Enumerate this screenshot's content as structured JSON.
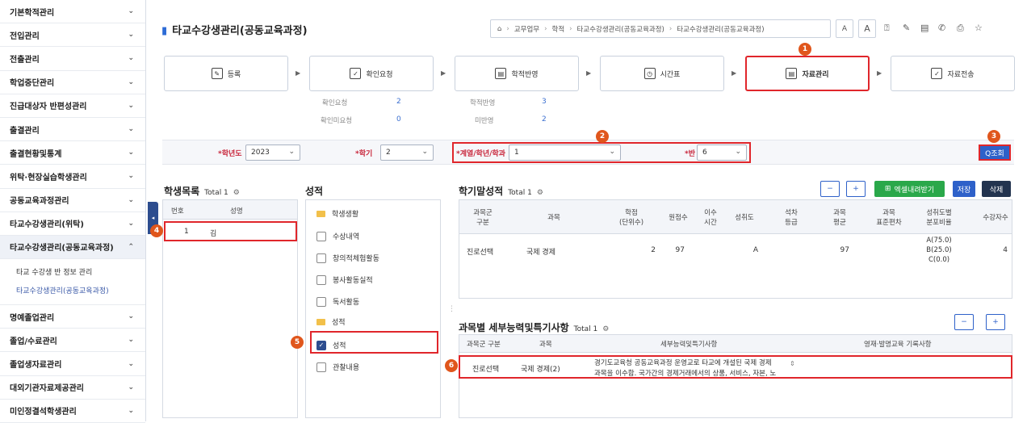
{
  "sidebar": {
    "items": [
      {
        "label": "기본학적관리"
      },
      {
        "label": "전입관리"
      },
      {
        "label": "전출관리"
      },
      {
        "label": "학업중단관리"
      },
      {
        "label": "진급대상자 반편성관리"
      },
      {
        "label": "출결관리"
      },
      {
        "label": "출결현황및통계"
      },
      {
        "label": "위탁·현장실습학생관리"
      },
      {
        "label": "공동교육과정관리"
      },
      {
        "label": "타교수강생관리(위탁)"
      },
      {
        "label": "타교수강생관리(공동교육과정)"
      }
    ],
    "subitems": [
      {
        "label": "타교 수강생 반 정보 관리"
      },
      {
        "label": "타교수강생관리(공동교육과정)"
      }
    ],
    "items_after": [
      {
        "label": "명예졸업관리"
      },
      {
        "label": "졸업/수료관리"
      },
      {
        "label": "졸업생자료관리"
      },
      {
        "label": "대외기관자료제공관리"
      },
      {
        "label": "미인정결석학생관리"
      }
    ]
  },
  "page": {
    "title": "타교수강생관리(공동교육과정)"
  },
  "breadcrumb": [
    "⌂",
    "교무업무",
    "학적",
    "타교수강생관리(공동교육과정)",
    "타교수강생관리(공동교육과정)"
  ],
  "toolbar": {
    "font_small": "A",
    "font_large": "A"
  },
  "steps": [
    {
      "label": "등록",
      "icon": "register-icon"
    },
    {
      "label": "확인요청",
      "icon": "check-request-icon"
    },
    {
      "label": "학적반영",
      "icon": "apply-icon"
    },
    {
      "label": "시간표",
      "icon": "clock-icon"
    },
    {
      "label": "자료관리",
      "icon": "data-icon"
    },
    {
      "label": "자료전송",
      "icon": "send-icon"
    }
  ],
  "stats": {
    "confirm_req_label": "확인요청",
    "confirm_req_value": "2",
    "unconfirm_label": "확인미요청",
    "unconfirm_value": "0",
    "applied_label": "학적반영",
    "applied_value": "3",
    "unapplied_label": "미반영",
    "unapplied_value": "2"
  },
  "filter": {
    "year_label": "*학년도",
    "year_value": "2023",
    "term_label": "*학기",
    "term_value": "2",
    "grade_label": "*계열/학년/학과",
    "grade_value": "1",
    "class_label": "*반",
    "class_value": "6",
    "search_label": "Q조회"
  },
  "students": {
    "title": "학생목록",
    "total": "Total 1",
    "col_no": "번호",
    "col_name": "성명",
    "rows": [
      {
        "no": "1",
        "name": "김"
      }
    ]
  },
  "grades_tree": {
    "title": "성적",
    "group1": "학생생활",
    "items1": [
      "수상내역",
      "창의적체험활동",
      "봉사활동실적",
      "독서활동"
    ],
    "group2": "성적",
    "items2": [
      "성적",
      "관찰내용"
    ]
  },
  "term_grades": {
    "title": "학기말성적",
    "total": "Total 1",
    "btn_minus": "−",
    "btn_plus": "+",
    "btn_excel": "엑셀내려받기",
    "btn_save": "저장",
    "btn_delete": "삭제",
    "headers": [
      "과목군\n구분",
      "과목",
      "학점\n(단위수)",
      "원점수",
      "이수\n시간",
      "성취도",
      "석차\n등급",
      "과목\n평균",
      "과목\n표준편차",
      "성취도별\n분포비율",
      "수강자수"
    ],
    "row": {
      "group": "진로선택",
      "subject": "국제 경제",
      "credit": "2",
      "score": "97",
      "hours": "",
      "achievement": "A",
      "rank": "",
      "avg": "97",
      "std": "",
      "dist": [
        "A(75.0)",
        "B(25.0)",
        "C(0.0)"
      ],
      "count": "4"
    }
  },
  "details": {
    "title": "과목별 세부능력및특기사항",
    "total": "Total 1",
    "btn_minus": "−",
    "btn_plus": "+",
    "headers": [
      "과목군 구분",
      "과목",
      "세부능력및특기사항",
      "영재·발명교육 기록사항"
    ],
    "row": {
      "group": "진로선택",
      "subject": "국제 경제(2)",
      "text1": "경기도교육청 공동교육과정 운영교로 타교에 개설된 국제 경제",
      "text2": "과목을 이수함. 국가간의 경제거래에서의 상품, 서비스, 자본, 노"
    }
  },
  "badges": [
    "1",
    "2",
    "3",
    "4",
    "5",
    "6"
  ]
}
